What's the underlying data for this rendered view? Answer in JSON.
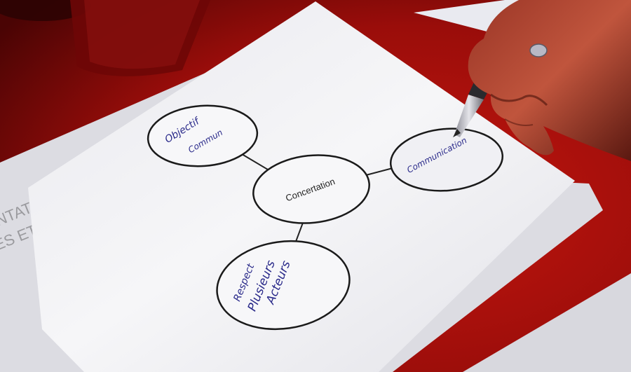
{
  "photo": {
    "subject": "hand drawing a mind map on paper with a pen",
    "colors": {
      "tablecloth": "#b3120e",
      "tablecloth_dark": "#5e0606",
      "paper": "#f3f3f5",
      "ink_blue": "#2a2a8a",
      "circle_stroke": "#1a1a1a"
    }
  },
  "diagram": {
    "center_label": "Concertation",
    "nodes": {
      "top_left": [
        "Objectif",
        "Commun"
      ],
      "right": "Communication",
      "bottom": [
        "Respect",
        "Plusieurs",
        "Acteurs"
      ]
    }
  },
  "background_sheet": {
    "faded_lines": [
      "ENTATION ET",
      "ES ET CONSTRUCTIO"
    ]
  }
}
